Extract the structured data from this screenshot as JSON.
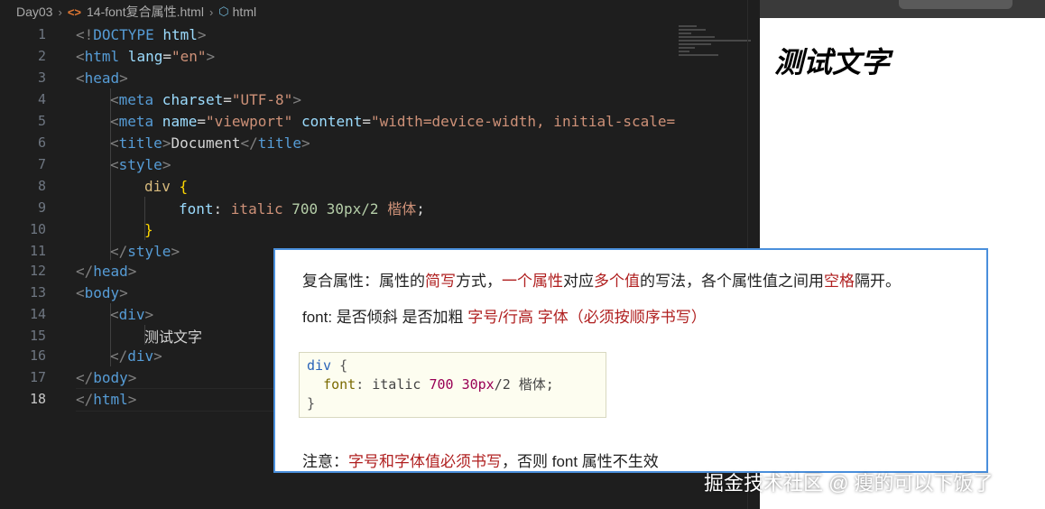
{
  "breadcrumb": {
    "folder": "Day03",
    "file": "14-font复合属性.html",
    "symbol": "html"
  },
  "editor": {
    "line_numbers": [
      "1",
      "2",
      "3",
      "4",
      "5",
      "6",
      "7",
      "8",
      "9",
      "10",
      "11",
      "12",
      "13",
      "14",
      "15",
      "16",
      "17",
      "18"
    ],
    "active_line": "18",
    "code": {
      "l1": {
        "a": "<!",
        "b": "DOCTYPE",
        "c": " html",
        "d": ">"
      },
      "l2": {
        "a": "<",
        "b": "html",
        "c": " lang",
        "d": "=",
        "e": "\"en\"",
        "f": ">"
      },
      "l3": {
        "a": "<",
        "b": "head",
        "c": ">"
      },
      "l4": {
        "a": "<",
        "b": "meta",
        "c": " charset",
        "d": "=",
        "e": "\"UTF-8\"",
        "f": ">"
      },
      "l5": {
        "a": "<",
        "b": "meta",
        "c": " name",
        "d": "=",
        "e": "\"viewport\"",
        "f": " content",
        "g": "=",
        "h": "\"width=device-width, initial-scale="
      },
      "l6": {
        "a": "<",
        "b": "title",
        "c": ">",
        "d": "Document",
        "e": "</",
        "f": "title",
        "g": ">"
      },
      "l7": {
        "a": "<",
        "b": "style",
        "c": ">"
      },
      "l8": {
        "a": "div",
        "b": " {"
      },
      "l9": {
        "a": "font",
        "b": ": ",
        "c": "italic ",
        "d": "700 30px/2",
        "e": " 楷体",
        "f": ";"
      },
      "l10": {
        "a": "}"
      },
      "l11": {
        "a": "</",
        "b": "style",
        "c": ">"
      },
      "l12": {
        "a": "</",
        "b": "head",
        "c": ">"
      },
      "l13": {
        "a": "<",
        "b": "body",
        "c": ">"
      },
      "l14": {
        "a": "<",
        "b": "div",
        "c": ">"
      },
      "l15": {
        "a": "测试文字"
      },
      "l16": {
        "a": "</",
        "b": "div",
        "c": ">"
      },
      "l17": {
        "a": "</",
        "b": "body",
        "c": ">"
      },
      "l18": {
        "a": "</",
        "b": "html",
        "c": ">"
      }
    }
  },
  "preview": {
    "text": "测试文字"
  },
  "note": {
    "line1": {
      "p1": "复合属性：属性的",
      "p2": "简写",
      "p3": "方式，",
      "p4": "一个属性",
      "p5": "对应",
      "p6": "多个值",
      "p7": "的写法，各个属性值之间用",
      "p8": "空格",
      "p9": "隔开。"
    },
    "line2": {
      "p1": "font: 是否倾斜  是否加粗  ",
      "p2": "字号/行高 字体（必须按顺序书写）"
    },
    "codebox": {
      "l1a": "div",
      "l1b": " {",
      "l2a": "font",
      "l2b": ": ",
      "l2c": "italic ",
      "l2d": "700",
      "l2e": " 30",
      "l2f": "px",
      "l2g": "/2",
      "l2h": " 楷体;",
      "l3": "}"
    },
    "line3": {
      "p1": "注意：",
      "p2": "字号和字体值必须书写",
      "p3": "，否则 font 属性不生效"
    }
  },
  "watermark": "掘金技术社区 @ 瘦的可以下饭了"
}
